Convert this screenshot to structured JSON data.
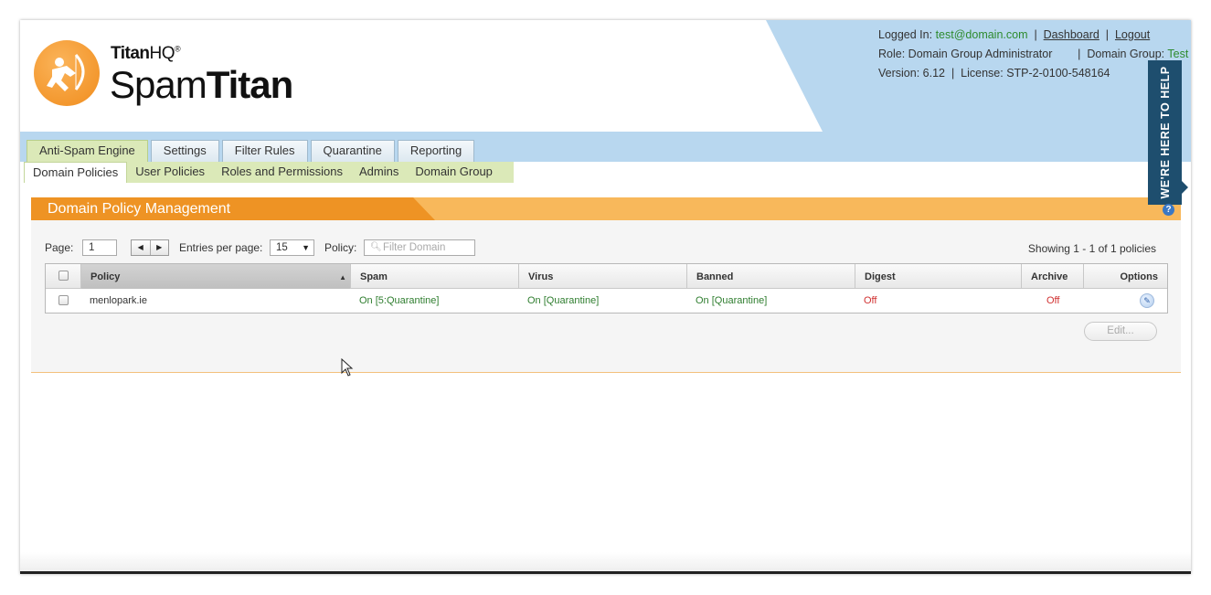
{
  "brand": {
    "company_bold": "Titan",
    "company_thin": "HQ",
    "trademark": "®",
    "product_thin": "Spam",
    "product_bold": "Titan",
    "logo_icon": "runner-archer-icon"
  },
  "header": {
    "logged_in_label": "Logged In:",
    "user_email": "test@domain.com",
    "sep": "|",
    "dashboard_link": "Dashboard",
    "logout_link": "Logout",
    "role_label": "Role:",
    "role_value": "Domain Group Administrator",
    "domain_group_label": "Domain Group:",
    "domain_group_value": "Test",
    "version_label": "Version:",
    "version_value": "6.12",
    "license_label": "License:",
    "license_value": "STP-2-0100-548164"
  },
  "help_tab": {
    "label": "WE'RE HERE TO HELP"
  },
  "nav": {
    "tabs": [
      "Anti-Spam Engine",
      "Settings",
      "Filter Rules",
      "Quarantine",
      "Reporting"
    ],
    "active_tab": "Anti-Spam Engine",
    "subtabs": [
      "Domain Policies",
      "User Policies",
      "Roles and Permissions",
      "Admins",
      "Domain Group"
    ],
    "active_subtab": "Domain Policies"
  },
  "panel": {
    "title": "Domain Policy Management",
    "help_glyph": "?",
    "page_label": "Page:",
    "page_value": "1",
    "prev_glyph": "◀",
    "next_glyph": "▶",
    "entries_label": "Entries per page:",
    "entries_value": "15",
    "dropdown_glyph": "▼",
    "policy_label": "Policy:",
    "filter_placeholder": "Filter Domain",
    "showing_text": "Showing 1 - 1 of 1 policies",
    "edit_button": "Edit..."
  },
  "table": {
    "columns": [
      "Policy",
      "Spam",
      "Virus",
      "Banned",
      "Digest",
      "Archive",
      "Options"
    ],
    "sorted_column": "Policy",
    "sort_glyph": "▲",
    "rows": [
      {
        "policy": "menlopark.ie",
        "spam": "On [5:Quarantine]",
        "virus": "On [Quarantine]",
        "banned": "On [Quarantine]",
        "digest": "Off",
        "archive": "Off",
        "options_icon": "pencil-icon"
      }
    ]
  },
  "colors": {
    "header_blue": "#b8d7ef",
    "nav_green": "#dbe9b8",
    "panel_orange": "#ee9324",
    "panel_orange_light": "#f8b85b",
    "help_tab_navy": "#1e4e6e",
    "on_green": "#2e7d2e",
    "off_red": "#d03030"
  }
}
